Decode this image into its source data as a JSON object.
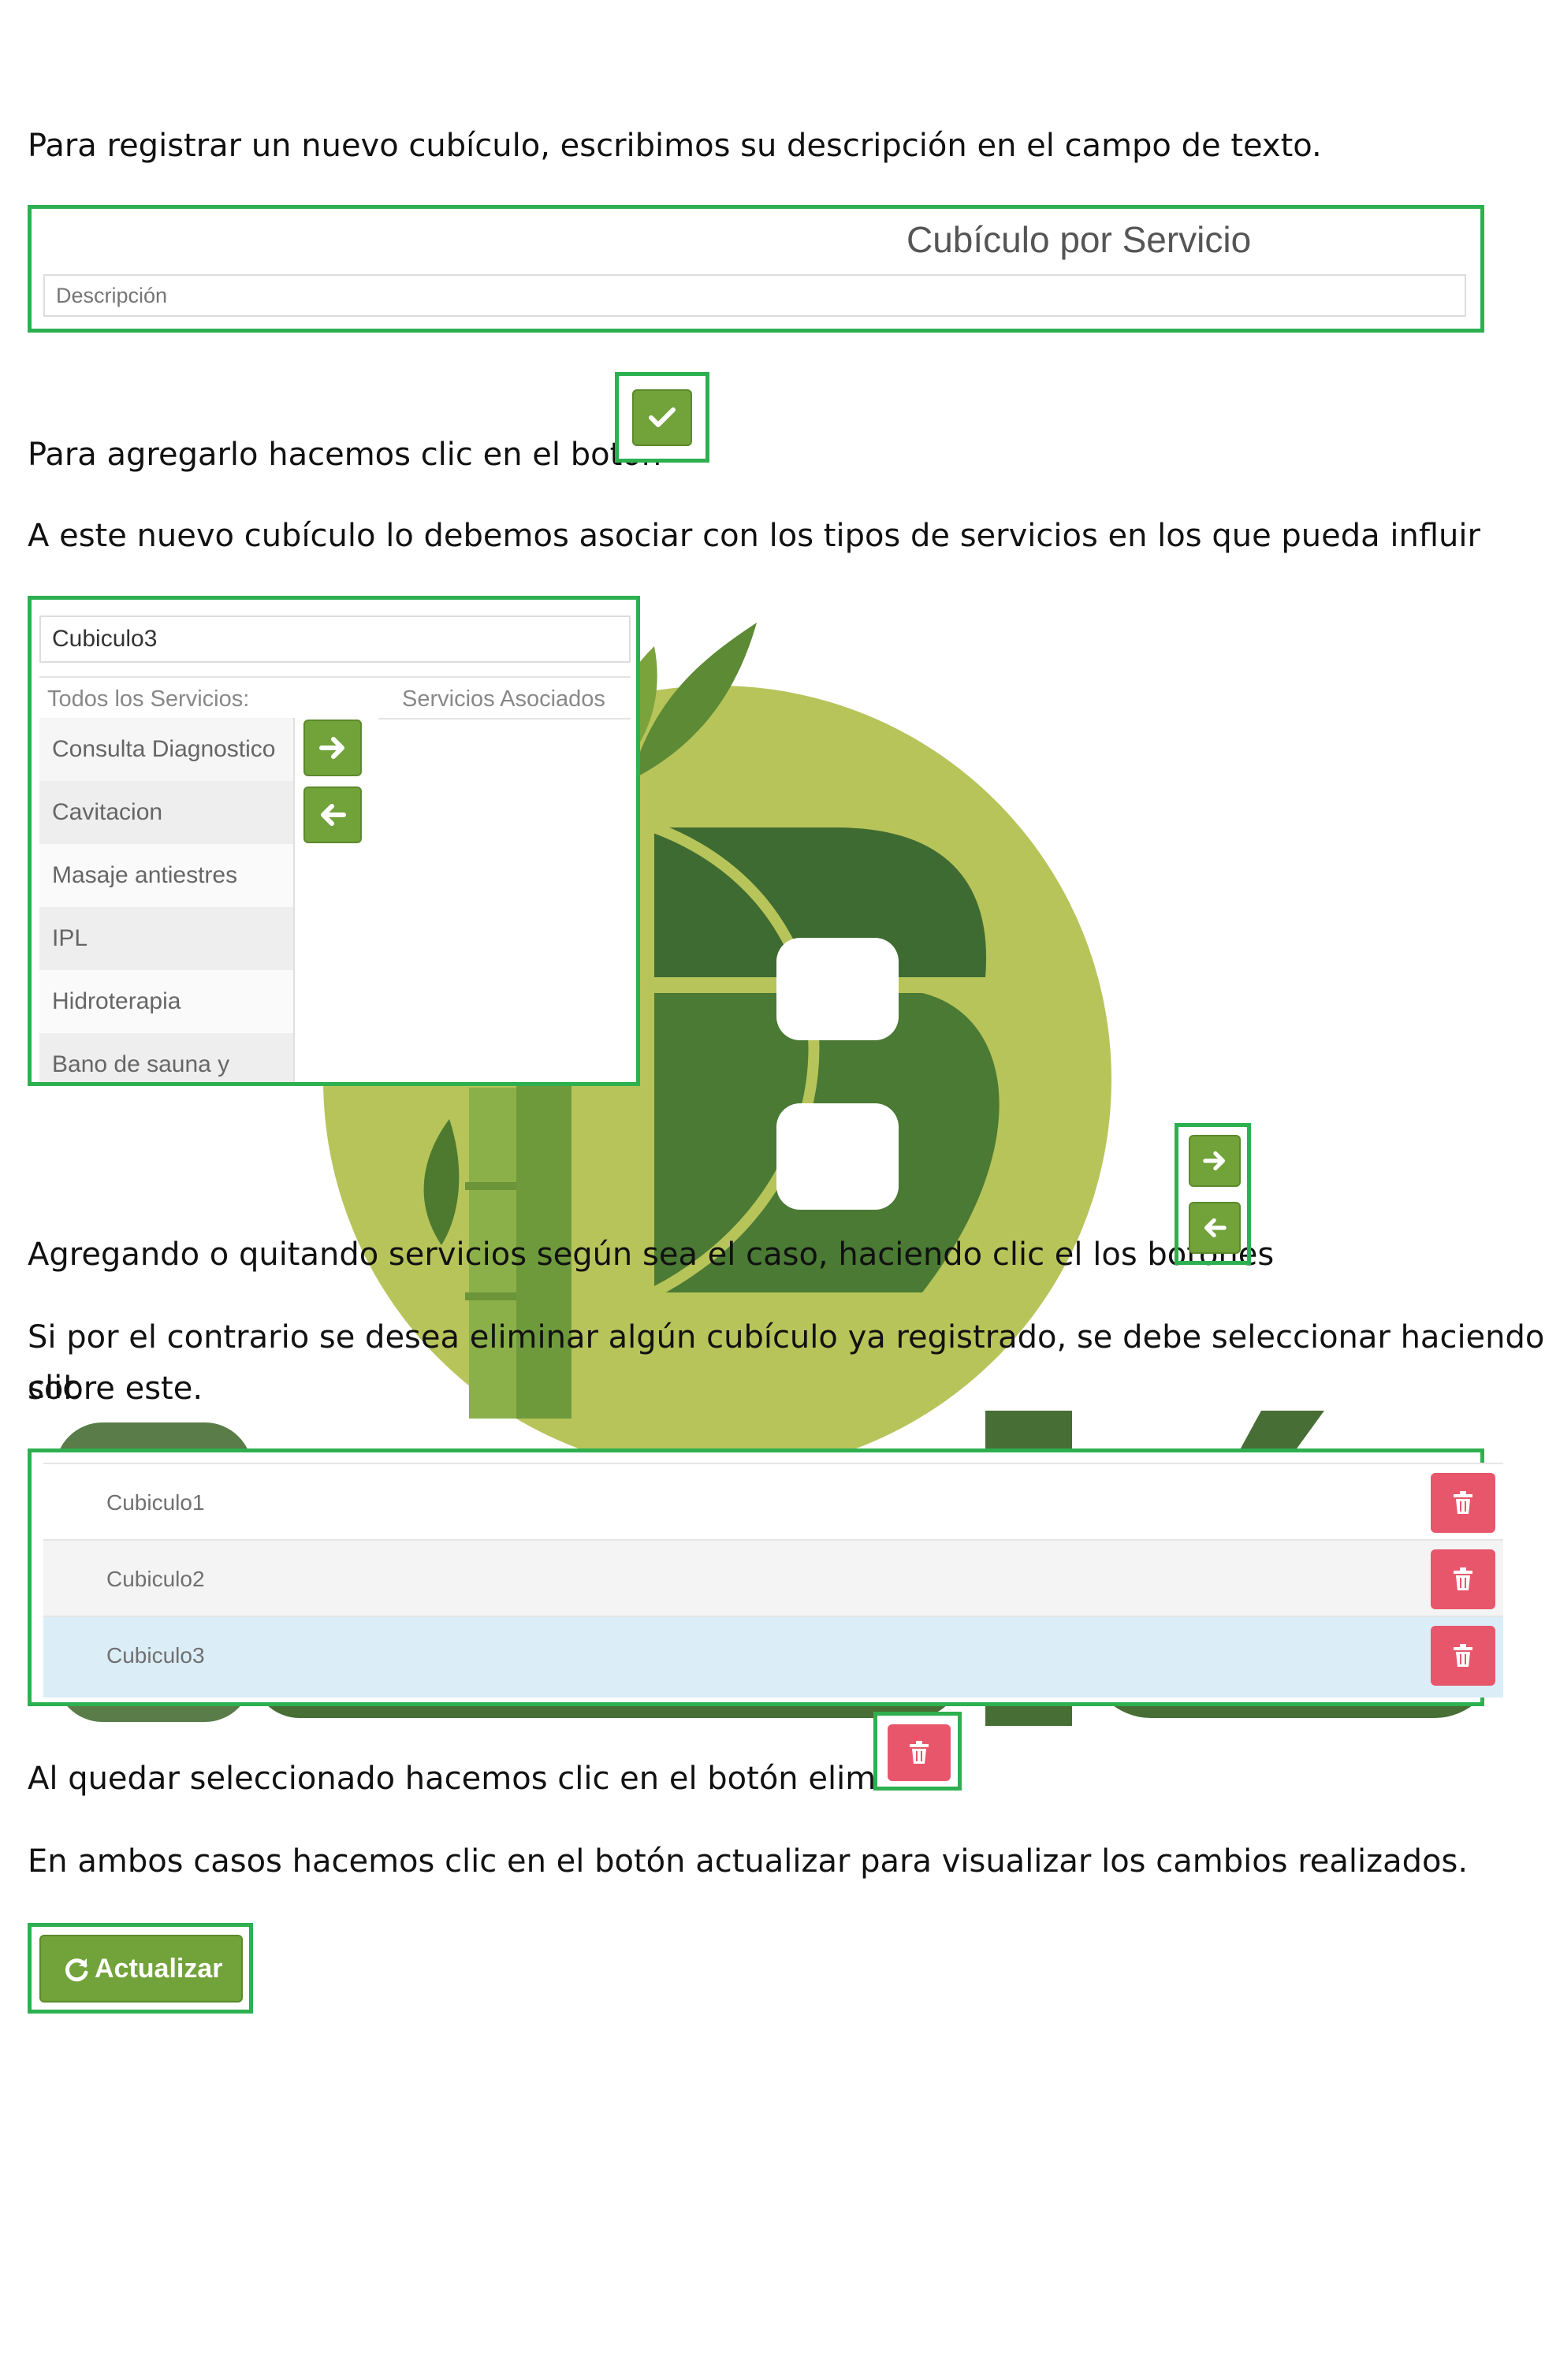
{
  "paragraphs": {
    "p1": "Para registrar un nuevo cubículo, escribimos su descripción en el campo de texto.",
    "p2": "Para agregarlo hacemos clic en el boton",
    "p3": "A este nuevo cubículo  lo debemos asociar con los tipos de servicios en los que pueda influir",
    "p4": "Agregando o quitando servicios según sea el caso, haciendo clic el los botones",
    "p5a": "Si por el contrario se desea eliminar algún cubículo ya registrado, se debe seleccionar haciendo clic",
    "p5b": "sobre este.",
    "p6": "Al quedar seleccionado hacemos clic en el botón eliminar",
    "p7": "En ambos casos hacemos clic en el botón actualizar para visualizar los cambios realizados."
  },
  "form_panel": {
    "title": "Cubículo por Servicio",
    "description_placeholder": "Descripción"
  },
  "services_panel": {
    "name_value": "Cubiculo3",
    "all_services_label": "Todos los Servicios:",
    "associated_label": "Servicios Asociados",
    "services": [
      "Consulta Diagnostico",
      "Cavitacion",
      "Masaje antiestres",
      "IPL",
      "Hidroterapia",
      "Bano de sauna y"
    ]
  },
  "cubicle_list": {
    "rows": [
      {
        "name": "Cubiculo1",
        "selected": false
      },
      {
        "name": "Cubiculo2",
        "selected": false
      },
      {
        "name": "Cubiculo3",
        "selected": true
      }
    ]
  },
  "update_button": {
    "label": "Actualizar"
  },
  "icons": {
    "confirm": "check-icon",
    "add": "arrow-right-icon",
    "remove": "arrow-left-icon",
    "delete": "trash-icon",
    "refresh": "refresh-icon"
  },
  "colors": {
    "frame": "#2db04f",
    "green_button": "#72a23a",
    "red_button": "#e8566b",
    "selected_row": "#dff0f8",
    "watermark_light": "#b4c45a",
    "watermark_dark": "#3f6b33"
  }
}
